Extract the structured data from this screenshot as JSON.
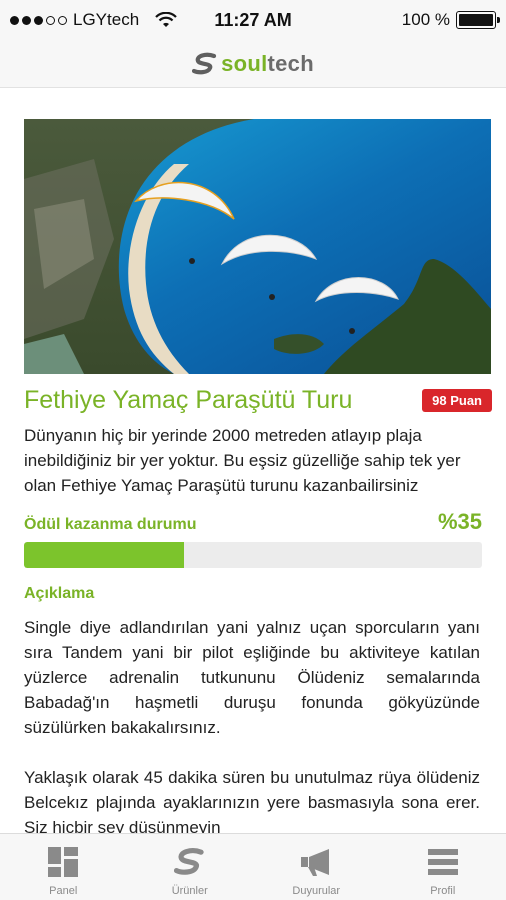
{
  "status_bar": {
    "carrier": "LGYtech",
    "time": "11:27 AM",
    "battery": "100 %",
    "battery_level": 1.0
  },
  "nav": {
    "logo_soul": "soul",
    "logo_tech": "tech"
  },
  "item": {
    "title": "Fethiye Yamaç Paraşütü Turu",
    "badge": "98 Puan",
    "summary": "Dünyanın hiç bir yerinde 2000 metreden atlayıp plaja inebildiğiniz bir yer yoktur. Bu eşsiz güzelliğe sahip tek yer olan Fethiye Yamaç Paraşütü turunu kazanbailirsiniz"
  },
  "progress": {
    "label": "Ödül kazanma durumu",
    "value_text": "%35",
    "value": 35
  },
  "description": {
    "heading": "Açıklama",
    "paragraph_1": "Single diye adlandırılan yani yalnız uçan sporcuların yanı sıra Tandem yani bir pilot eşliğinde bu aktiviteye katılan yüzlerce adrenalin tutkununu Ölüdeniz semalarında Babadağ'ın haşmetli duruşu fonunda gökyüzünde süzülürken bakakalırsınız.",
    "paragraph_2": "Yaklaşık olarak 45 dakika süren bu unutulmaz rüya ölüdeniz Belcekız plajında ayaklarınızın yere basmasıyla sona erer. Siz hiçbir şey düşünmeyin"
  },
  "tabs": [
    {
      "label": "Panel",
      "icon": "dashboard-icon"
    },
    {
      "label": "Ürünler",
      "icon": "soultech-logo-icon"
    },
    {
      "label": "Duyurular",
      "icon": "megaphone-icon"
    },
    {
      "label": "Profil",
      "icon": "menu-icon"
    }
  ],
  "colors": {
    "accent": "#7ab327",
    "badge": "#d9262b",
    "progress_fill": "#7cc42c",
    "progress_track": "#ececec"
  }
}
